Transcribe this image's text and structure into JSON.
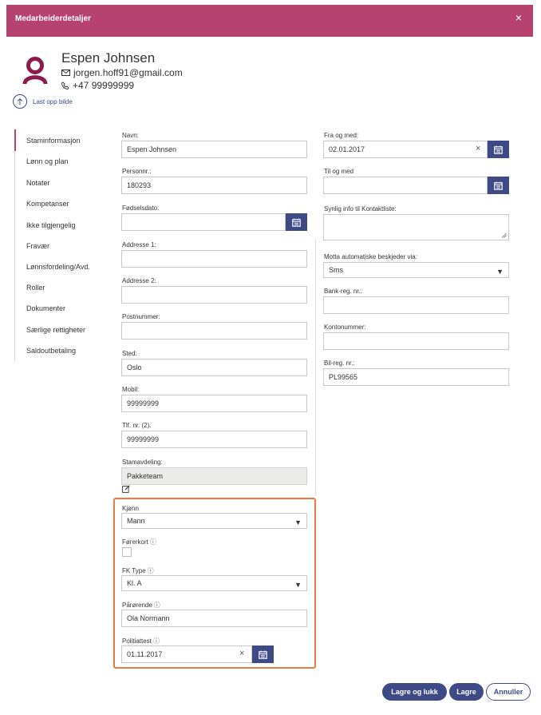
{
  "dialog": {
    "title": "Medarbeiderdetaljer",
    "close_glyph": "×"
  },
  "employee": {
    "name": "Espen Johnsen",
    "email": "jorgen.hoff91@gmail.com",
    "phone": "+47 99999999",
    "upload_label": "Last opp bilde"
  },
  "nav": {
    "items": [
      {
        "label": "Staminformasjon",
        "active": true
      },
      {
        "label": "Lønn og plan"
      },
      {
        "label": "Notater"
      },
      {
        "label": "Kompetanser"
      },
      {
        "label": "Ikke tilgjengelig"
      },
      {
        "label": "Fravær"
      },
      {
        "label": "Lønnsfordeling/Avd."
      },
      {
        "label": "Roller"
      },
      {
        "label": "Dokumenter"
      },
      {
        "label": "Særlige rettigheter"
      },
      {
        "label": "Saldoutbetaling"
      }
    ]
  },
  "left": {
    "navn": {
      "label": "Navn:",
      "value": "Espen Johnsen"
    },
    "personnr": {
      "label": "Personnr.:",
      "value": "180293"
    },
    "fodselsdato": {
      "label": "Fødselsdato:",
      "value": ""
    },
    "addresse1": {
      "label": "Addresse 1:",
      "value": ""
    },
    "addresse2": {
      "label": "Addresse 2:",
      "value": ""
    },
    "postnummer": {
      "label": "Postnummer:",
      "value": ""
    },
    "sted": {
      "label": "Sted:",
      "value": "Oslo"
    },
    "mobil": {
      "label": "Mobil:",
      "value": "99999999"
    },
    "tlf2": {
      "label": "Tlf. nr. (2).",
      "value": "99999999"
    },
    "stamavdeling": {
      "label": "Stamavdeling:",
      "value": "Pakketeam"
    }
  },
  "custom": {
    "kjonn": {
      "label": "Kjønn",
      "value": "Mann"
    },
    "forerkort": {
      "label": "Førerkort",
      "checked": false
    },
    "fk_type": {
      "label": "FK Type",
      "value": "Kl. A"
    },
    "parorende": {
      "label": "Pårørende",
      "value": "Ola Normann"
    },
    "politiattest": {
      "label": "Politiattest",
      "value": "01.11.2017"
    },
    "info_glyph": "ⓘ"
  },
  "right": {
    "fra_og_med": {
      "label": "Fra og med:",
      "value": "02.01.2017"
    },
    "til_og_med": {
      "label": "Til og med",
      "value": ""
    },
    "synlig_info": {
      "label": "Synlig info til Kontaktliste:",
      "value": ""
    },
    "motta": {
      "label": "Motta automatiske beskjeder via:",
      "value": "Sms"
    },
    "bank_reg": {
      "label": "Bank-reg. nr.:",
      "value": ""
    },
    "kontonummer": {
      "label": "Kontonummer:",
      "value": ""
    },
    "bil_reg": {
      "label": "Bil-reg. nr.:",
      "value": "PL99565"
    }
  },
  "glyphs": {
    "clear": "×",
    "dropdown": "▼"
  },
  "footer": {
    "save_close": "Lagre og lukk",
    "save": "Lagre",
    "cancel": "Annuller"
  },
  "colors": {
    "header": "#b5426f",
    "primary": "#3d4a86",
    "highlight": "#ee7a3e",
    "avatar": "#8a1b4c"
  },
  "icons": [
    "close-icon",
    "avatar-icon",
    "mail-icon",
    "phone-icon",
    "upload-icon",
    "calendar-icon",
    "clear-icon",
    "dropdown-arrow-icon",
    "info-icon",
    "edit-icon",
    "resize-icon"
  ]
}
